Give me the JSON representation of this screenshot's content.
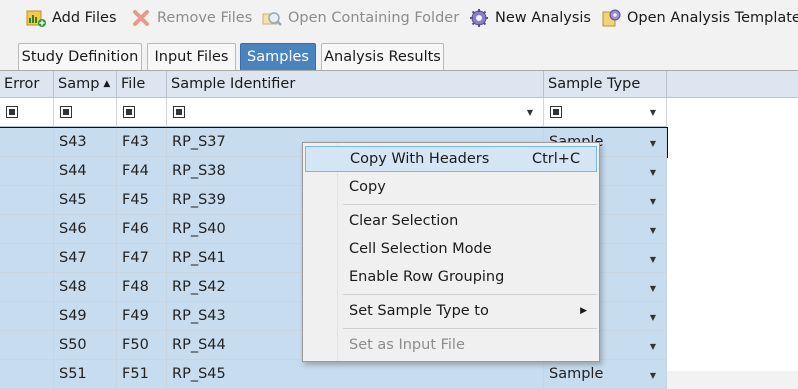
{
  "toolbar": {
    "add_files": "Add Files",
    "remove_files": "Remove Files",
    "open_containing_folder": "Open Containing Folder",
    "new_analysis": "New Analysis",
    "open_analysis_template": "Open Analysis Template"
  },
  "tabs": [
    {
      "label": "Study Definition"
    },
    {
      "label": "Input Files"
    },
    {
      "label": "Samples"
    },
    {
      "label": "Analysis Results"
    }
  ],
  "grid": {
    "headers": {
      "error": "Error",
      "sample": "Samp",
      "file": "File",
      "identifier": "Sample Identifier",
      "type": "Sample Type"
    },
    "rows": [
      {
        "sample": "S43",
        "file": "F43",
        "identifier": "RP_S37",
        "type": "Sample"
      },
      {
        "sample": "S44",
        "file": "F44",
        "identifier": "RP_S38",
        "type": ""
      },
      {
        "sample": "S45",
        "file": "F45",
        "identifier": "RP_S39",
        "type": ""
      },
      {
        "sample": "S46",
        "file": "F46",
        "identifier": "RP_S40",
        "type": ""
      },
      {
        "sample": "S47",
        "file": "F47",
        "identifier": "RP_S41",
        "type": ""
      },
      {
        "sample": "S48",
        "file": "F48",
        "identifier": "RP_S42",
        "type": ""
      },
      {
        "sample": "S49",
        "file": "F49",
        "identifier": "RP_S43",
        "type": ""
      },
      {
        "sample": "S50",
        "file": "F50",
        "identifier": "RP_S44",
        "type": ""
      },
      {
        "sample": "S51",
        "file": "F51",
        "identifier": "RP_S45",
        "type": "Sample"
      }
    ]
  },
  "context_menu": {
    "copy_with_headers": "Copy With Headers",
    "copy_with_headers_shortcut": "Ctrl+C",
    "copy": "Copy",
    "clear_selection": "Clear Selection",
    "cell_selection_mode": "Cell Selection Mode",
    "enable_row_grouping": "Enable Row Grouping",
    "set_sample_type_to": "Set Sample Type to",
    "set_as_input_file": "Set as Input File"
  },
  "colors": {
    "active_tab": "#4a84bf",
    "header_bg": "#dde6f0",
    "selected_row": "#c7dcef",
    "menu_highlight": "#d4e6f5"
  }
}
